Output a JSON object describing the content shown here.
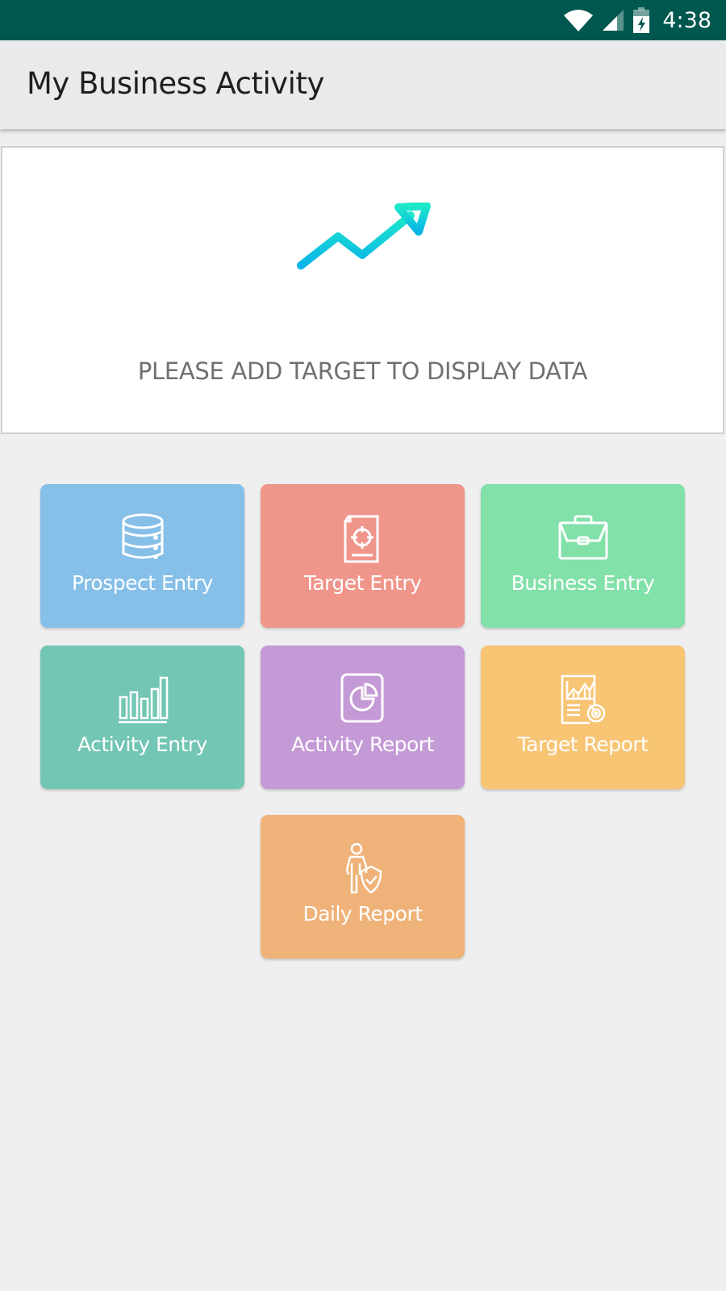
{
  "status_bar": {
    "time": "4:38",
    "icons": [
      "wifi-icon",
      "cell-signal-icon",
      "battery-charging-icon"
    ],
    "background": "#00574e"
  },
  "app_bar": {
    "title": "My Business Activity"
  },
  "target_card": {
    "icon": "trending-up-chart-icon",
    "message": "PLEASE ADD TARGET TO DISPLAY DATA"
  },
  "tiles": [
    {
      "label": "Prospect Entry",
      "icon": "database-icon",
      "color": "#86bfe8"
    },
    {
      "label": "Target Entry",
      "icon": "target-document-icon",
      "color": "#f0958a"
    },
    {
      "label": "Business Entry",
      "icon": "briefcase-icon",
      "color": "#82e0a9"
    },
    {
      "label": "Activity Entry",
      "icon": "bar-chart-icon",
      "color": "#73c6b4"
    },
    {
      "label": "Activity Report",
      "icon": "pie-chart-report-icon",
      "color": "#c49ad6"
    },
    {
      "label": "Target Report",
      "icon": "target-report-icon",
      "color": "#f7c574"
    },
    {
      "label": "Daily Report",
      "icon": "person-shield-icon",
      "color": "#efb278"
    }
  ]
}
